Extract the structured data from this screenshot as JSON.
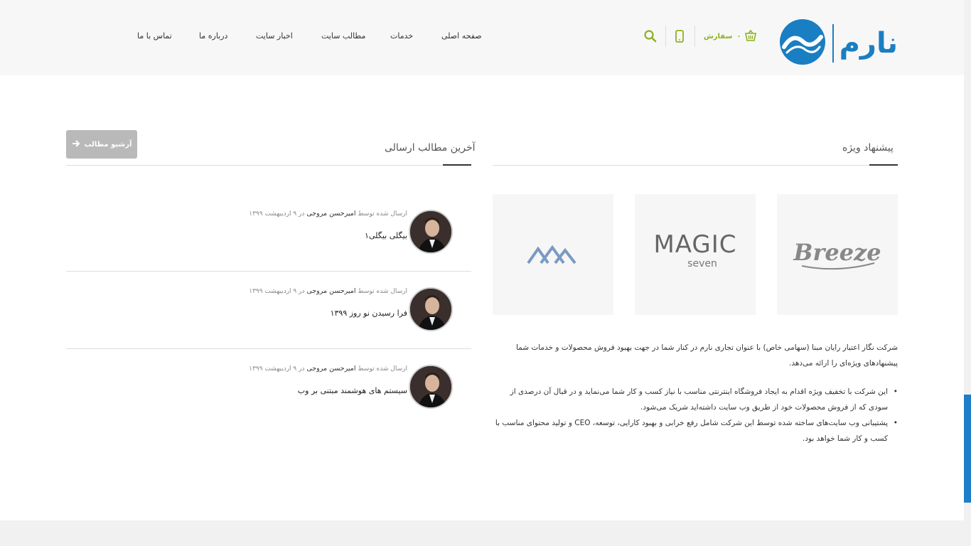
{
  "header": {
    "logo_text": "نارم",
    "cart": {
      "count": "۰",
      "label": "سفارش"
    },
    "nav": [
      "صفحه اصلی",
      "خدمات",
      "مطالب سایت",
      "اخبار سایت",
      "درباره ما",
      "تماس با ما"
    ]
  },
  "featured": {
    "title": "پیشنهاد ویژه",
    "brands": [
      "Breeze",
      "MAGIC seven",
      "mountain-logo"
    ],
    "magic_top": "MAGIC",
    "magic_bottom": "seven",
    "breeze": "Breeze",
    "description": "شرکت نگار اعتبار رایان مبنا (سهامی خاص) با عنوان تجاری نارم در کنار شما در جهت بهبود فروش محصولات و خدمات شما پیشنهادهای ویژه‌ای را ارائه می‌دهد.",
    "bullets": [
      "این شرکت با تخفیف ویژه اقدام به ایجاد فروشگاه اینترنتی مناسب با نیاز کسب و کار شما می‌نماید و در قبال آن درصدی از سودی که از فروش محصولات خود از طریق وب سایت داشته‌اید شریک می‌شود.",
      "پشتیبانی وب سایت‌های ساخته شده توسط این شرکت شامل رفع خرابی و بهبود کارایی، توسعه، CEO و تولید محتوای مناسب با کسب و کار شما خواهد بود."
    ]
  },
  "latest": {
    "title": "آخرین مطالب ارسالی",
    "archive_button": "آرشیو مطالب",
    "posts": [
      {
        "meta_prefix": "ارسال شده توسط",
        "author": "امیرحسن مروجی",
        "meta_suffix": "در ۹ اردیبهشت ۱۳۹۹",
        "title": "بیگلی بیگلی۱"
      },
      {
        "meta_prefix": "ارسال شده توسط",
        "author": "امیرحسن مروجی",
        "meta_suffix": "در ۹ اردیبهشت ۱۳۹۹",
        "title": "فرا رسیدن نو روز ۱۳۹۹"
      },
      {
        "meta_prefix": "ارسال شده توسط",
        "author": "امیرحسن مروجی",
        "meta_suffix": "در ۹ اردیبهشت ۱۳۹۹",
        "title": "سیستم های هوشمند مبتنی بر وب"
      }
    ]
  },
  "colors": {
    "accent": "#8cb123",
    "brand_blue": "#1e7fc8",
    "button_gray": "#b9b9b9"
  },
  "icons": [
    "basket-icon",
    "mobile-icon",
    "search-icon",
    "arrow-right-icon"
  ]
}
